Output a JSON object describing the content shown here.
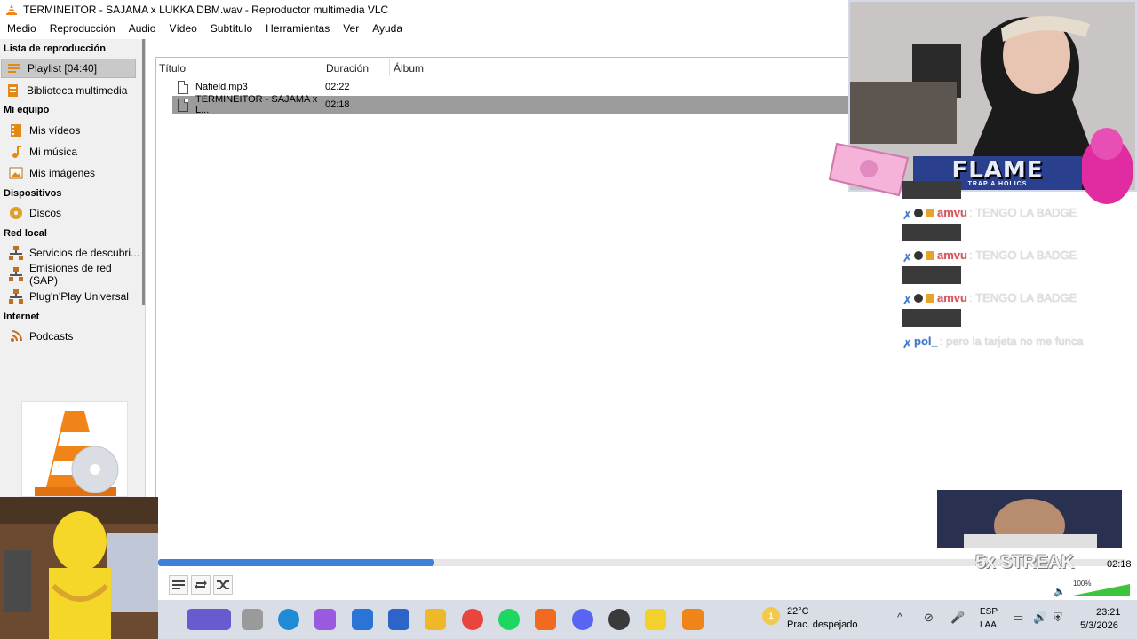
{
  "window": {
    "title": "TERMINEITOR - SAJAMA x LUKKA DBM.wav - Reproductor multimedia VLC"
  },
  "menu": [
    "Medio",
    "Reproducción",
    "Audio",
    "Vídeo",
    "Subtítulo",
    "Herramientas",
    "Ver",
    "Ayuda"
  ],
  "sidebar": {
    "playlist_header": "Lista de reproducción",
    "playlist_item": "Playlist [04:40]",
    "library_item": "Biblioteca multimedia",
    "my_computer_header": "Mi equipo",
    "videos": "Mis vídeos",
    "music": "Mi música",
    "images": "Mis imágenes",
    "devices_header": "Dispositivos",
    "discs": "Discos",
    "lan_header": "Red local",
    "discovery": "Servicios de descubri...",
    "sap": "Emisiones de red (SAP)",
    "upnp": "Plug'n'Play Universal",
    "internet_header": "Internet",
    "podcasts": "Podcasts"
  },
  "playlist": {
    "columns": [
      "Título",
      "Duración",
      "Álbum"
    ],
    "rows": [
      {
        "title": "Nafield.mp3",
        "duration": "02:22",
        "album": ""
      },
      {
        "title": "TERMINEITOR - SAJAMA x L...",
        "duration": "02:18",
        "album": ""
      }
    ],
    "selected_row": 1
  },
  "player": {
    "elapsed_total": "02:18",
    "progress_fraction": 0.285,
    "volume_label": "100%",
    "volume_fraction": 1.0
  },
  "taskbar": {
    "weather_temp": "22°C",
    "weather_desc": "Prac. despejado",
    "weather_badge": "1",
    "lang_line1": "ESP",
    "lang_line2": "LAA",
    "time": "23:21",
    "date": "5/3/2026"
  },
  "stream_overlay": {
    "banner_title": "FLAME",
    "banner_sub": "TRAP A HOLICS",
    "chat": [
      {
        "user": "amvu",
        "message": "TENGO LA BADGE"
      },
      {
        "user": "amvu",
        "message": "TENGO LA BADGE"
      },
      {
        "user": "amvu",
        "message": "TENGO LA BADGE"
      },
      {
        "user": "pol_",
        "message": "pero la tarjeta no me funca"
      }
    ],
    "streak": "5x STREAK"
  },
  "colors": {
    "accent": "#3d82d6",
    "selection": "#9b9b9b",
    "vlc_orange": "#f08418",
    "chat_user_red": "#e0515a",
    "chat_user_blue": "#3a78d6"
  }
}
